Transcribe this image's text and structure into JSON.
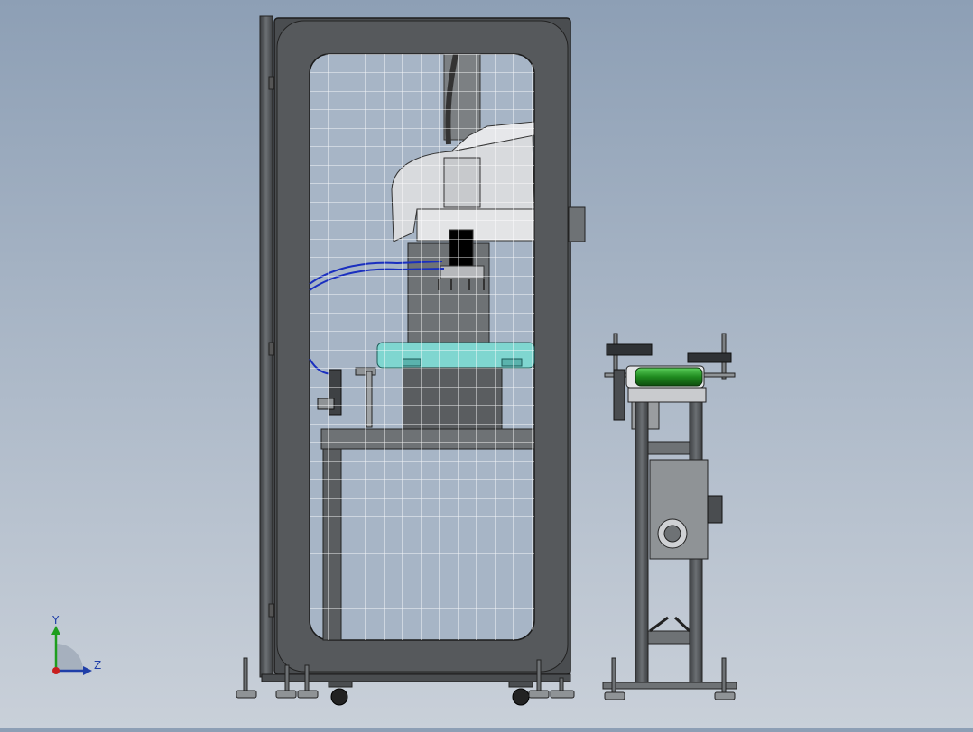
{
  "viewport": {
    "background_top": "#8d9fb5",
    "background_bottom": "#c9d0d9"
  },
  "model": {
    "frame_color": "#4a4d50",
    "mesh_color": "#ffffff",
    "robot_color": "#d8dadd",
    "fixture_color": "#7fd6d0",
    "roller_color": "#1f8a1f",
    "hose_color": "#1a2fbf"
  },
  "triad": {
    "y_label": "Y",
    "z_label": "Z",
    "y_color": "#1e9e1e",
    "z_color": "#1f3ea8",
    "x_color": "#c81e1e"
  }
}
